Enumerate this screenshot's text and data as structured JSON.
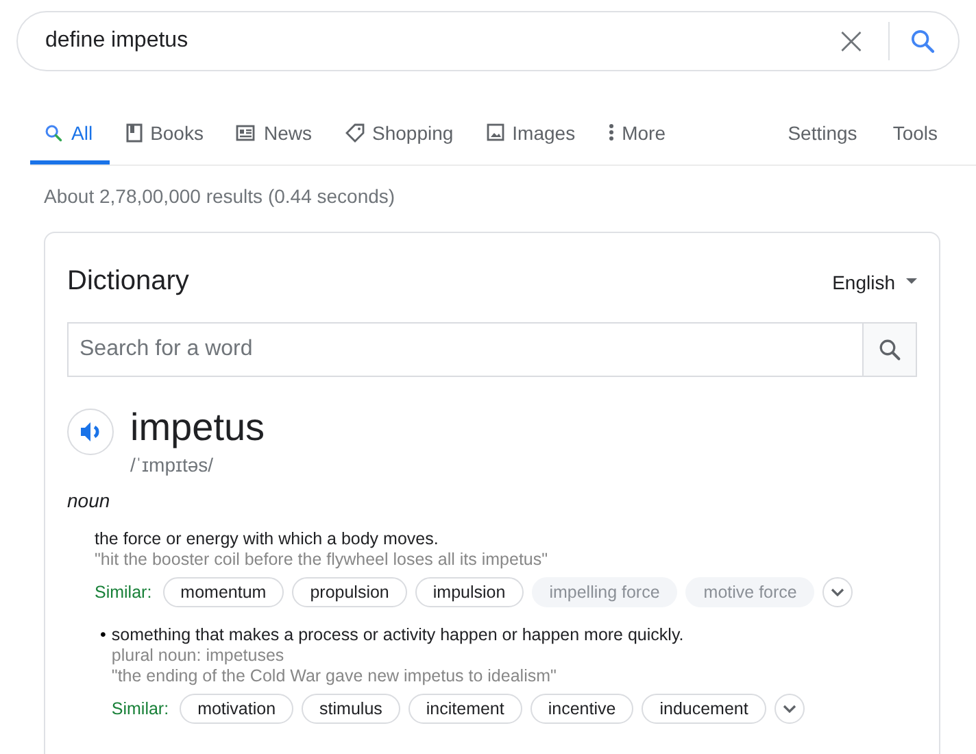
{
  "search": {
    "value": "define impetus",
    "clear": "×"
  },
  "tabs": [
    {
      "label": "All",
      "selected": true
    },
    {
      "label": "Books",
      "selected": false
    },
    {
      "label": "News",
      "selected": false
    },
    {
      "label": "Shopping",
      "selected": false
    },
    {
      "label": "Images",
      "selected": false
    },
    {
      "label": "More",
      "selected": false
    }
  ],
  "tools": [
    "Settings",
    "Tools"
  ],
  "result_stats": "About 2,78,00,000 results (0.44 seconds)",
  "dictionary": {
    "title": "Dictionary",
    "language": "English",
    "word_search": {
      "placeholder": "Search for a word"
    },
    "word": "impetus",
    "phonetic": "/ˈɪmpɪtəs/",
    "part_of_speech": "noun",
    "senses": [
      {
        "definition": "the force or energy with which a body moves.",
        "example": "\"hit the booster coil before the flywheel loses all its impetus\"",
        "similar_label": "Similar:",
        "similar": [
          {
            "word": "momentum",
            "faded": false
          },
          {
            "word": "propulsion",
            "faded": false
          },
          {
            "word": "impulsion",
            "faded": false
          },
          {
            "word": "impelling force",
            "faded": true
          },
          {
            "word": "motive force",
            "faded": true
          }
        ]
      },
      {
        "bullet": "•",
        "definition": "something that makes a process or activity happen or happen more quickly.",
        "plural": "plural noun: impetuses",
        "example": "\"the ending of the Cold War gave new impetus to idealism\"",
        "similar_label": "Similar:",
        "similar": [
          {
            "word": "motivation",
            "faded": false
          },
          {
            "word": "stimulus",
            "faded": false
          },
          {
            "word": "incitement",
            "faded": false
          },
          {
            "word": "incentive",
            "faded": false
          },
          {
            "word": "inducement",
            "faded": false
          }
        ]
      }
    ]
  }
}
